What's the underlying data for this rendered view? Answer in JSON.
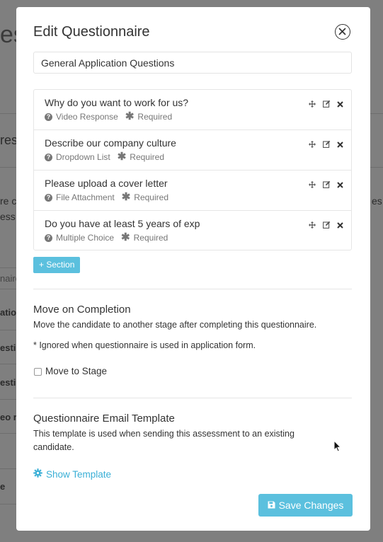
{
  "background": {
    "fragments": [
      "es",
      "res",
      "re c",
      "ess c",
      "es c",
      "naire",
      "atio",
      "esti",
      "esti",
      "eo re",
      "e"
    ]
  },
  "modal": {
    "title": "Edit Questionnaire",
    "close_icon": "close-circle-icon",
    "name_value": "General Application Questions",
    "questions": [
      {
        "title": "Why do you want to work for us?",
        "type": "Video Response",
        "required": "Required"
      },
      {
        "title": "Describe our company culture",
        "type": "Dropdown List",
        "required": "Required"
      },
      {
        "title": "Please upload a cover letter",
        "type": "File Attachment",
        "required": "Required"
      },
      {
        "title": "Do you have at least 5 years of exp",
        "type": "Multiple Choice",
        "required": "Required"
      }
    ],
    "section_button": "+ Section",
    "completion": {
      "heading": "Move on Completion",
      "description": "Move the candidate to another stage after completing this questionnaire.",
      "note": "* Ignored when questionnaire is used in application form.",
      "checkbox_label": "Move to Stage",
      "checkbox_checked": false
    },
    "email": {
      "heading": "Questionnaire Email Template",
      "description": "This template is used when sending this assessment to an existing candidate.",
      "show_template": "Show Template"
    },
    "save_button": "Save Changes"
  },
  "colors": {
    "accent": "#5bc0de",
    "link": "#3aafd6",
    "overlay": "#7f7f7f"
  }
}
